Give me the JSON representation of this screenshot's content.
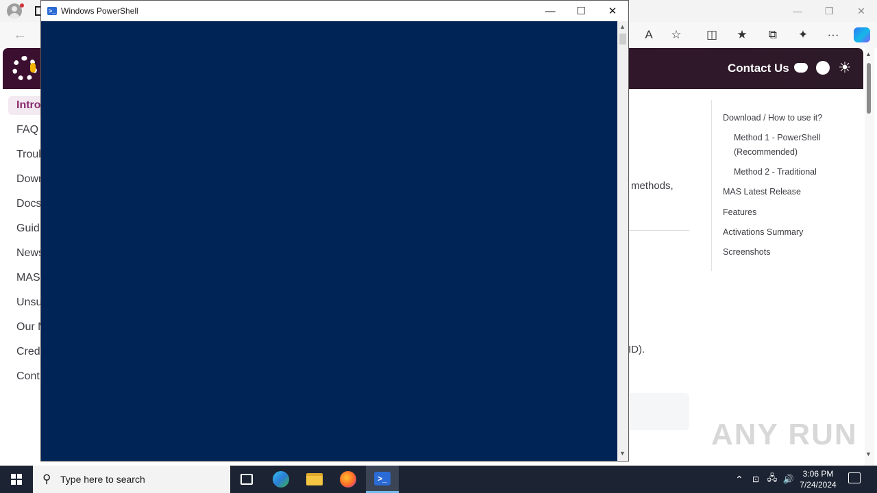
{
  "browser": {
    "window_controls": {
      "minimize": "—",
      "restore": "❐",
      "close": "✕"
    },
    "toolbar": {
      "back": "←",
      "read_aloud": "A",
      "favorite": "☆",
      "split": "◫",
      "favorites": "★",
      "collections": "⧉",
      "extensions": "✦",
      "more": "···"
    }
  },
  "site": {
    "header": {
      "contact": "Contact Us",
      "theme_icon": "☀"
    },
    "sidebar": {
      "items": [
        {
          "label": "Intro",
          "active": true
        },
        {
          "label": "FAQ"
        },
        {
          "label": "Troub"
        },
        {
          "label": "Down"
        },
        {
          "label": "Docs"
        },
        {
          "label": "Guid"
        },
        {
          "label": "News"
        },
        {
          "label": "MAS"
        },
        {
          "label": "Unsu"
        },
        {
          "label": "Our M"
        },
        {
          "label": "Cred"
        },
        {
          "label": "Cont"
        }
      ]
    },
    "main": {
      "frag_methods": "methods,",
      "frag_md": "ID)."
    },
    "toc": {
      "items": [
        {
          "label": "Download / How to use it?"
        },
        {
          "label": "Method 1 - PowerShell"
        },
        {
          "label": "(Recommended)"
        },
        {
          "label": "Method 2 - Traditional"
        },
        {
          "label": "MAS Latest Release"
        },
        {
          "label": "Features"
        },
        {
          "label": "Activations Summary"
        },
        {
          "label": "Screenshots"
        }
      ]
    },
    "watermark": "ANY RUN"
  },
  "powershell": {
    "title": "Windows PowerShell",
    "icon_glyph": ">_",
    "controls": {
      "minimize": "—",
      "maximize": "☐",
      "close": "✕"
    },
    "console_text": ""
  },
  "taskbar": {
    "search_placeholder": "Type here to search",
    "search_icon": "⚲",
    "tray": {
      "chevron": "⌃",
      "network": "🖧",
      "volume": "🔊"
    },
    "clock": {
      "time": "3:06 PM",
      "date": "7/24/2024"
    }
  },
  "colors": {
    "console_bg": "#012456",
    "site_header": "#3b0f2f",
    "accent": "#8a2a6e",
    "taskbar": "#1c2433"
  }
}
